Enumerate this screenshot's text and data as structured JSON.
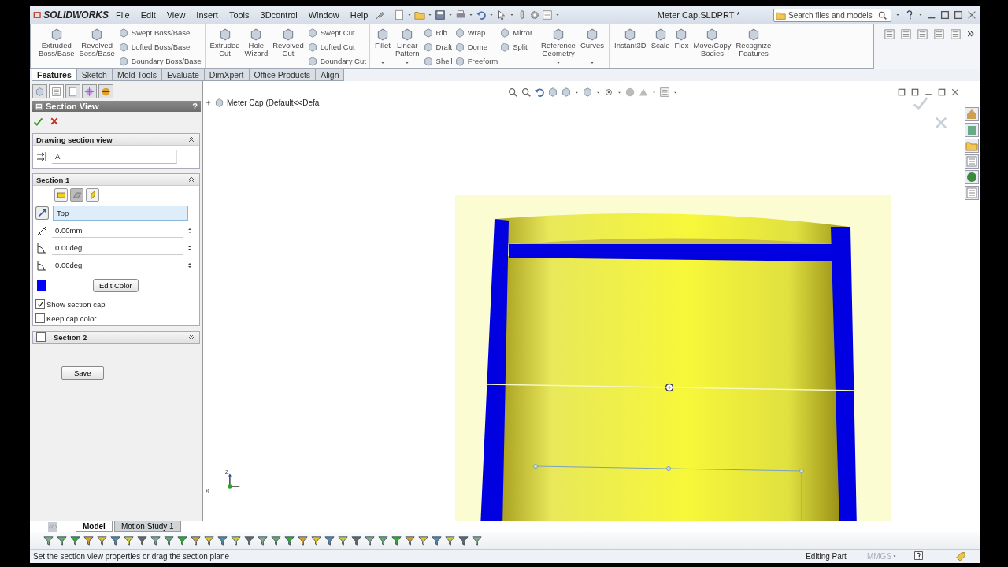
{
  "app": {
    "logo": "SOLIDWORKS",
    "menus": [
      "File",
      "Edit",
      "View",
      "Insert",
      "Tools",
      "3Dcontrol",
      "Window",
      "Help"
    ],
    "title": "Meter Cap.SLDPRT *",
    "search": {
      "placeholder": "Search files and models"
    }
  },
  "ribbon": {
    "groups": [
      [
        {
          "kind": "large",
          "label": "Extruded\nBoss/Base"
        },
        {
          "kind": "large",
          "label": "Revolved\nBoss/Base"
        },
        {
          "kind": "stack",
          "items": [
            "Swept Boss/Base",
            "Lofted Boss/Base",
            "Boundary Boss/Base"
          ]
        }
      ],
      [
        {
          "kind": "large",
          "label": "Extruded\nCut"
        },
        {
          "kind": "large",
          "label": "Hole\nWizard"
        },
        {
          "kind": "large",
          "label": "Revolved\nCut"
        },
        {
          "kind": "stack",
          "items": [
            "Swept Cut",
            "Lofted Cut",
            "Boundary Cut"
          ]
        }
      ],
      [
        {
          "kind": "drop",
          "label": "Fillet"
        },
        {
          "kind": "drop",
          "label": "Linear\nPattern"
        },
        {
          "kind": "stack",
          "items": [
            "Rib",
            "Draft",
            "Shell"
          ]
        },
        {
          "kind": "stack",
          "items": [
            "Wrap",
            "Dome",
            "Freeform"
          ]
        },
        {
          "kind": "stack",
          "items": [
            "Mirror",
            "Split"
          ]
        }
      ],
      [
        {
          "kind": "drop",
          "label": "Reference\nGeometry"
        },
        {
          "kind": "drop",
          "label": "Curves"
        }
      ],
      [
        {
          "kind": "large",
          "label": "Instant3D"
        },
        {
          "kind": "large",
          "label": "Scale"
        },
        {
          "kind": "large",
          "label": "Flex"
        },
        {
          "kind": "large",
          "label": "Move/Copy\nBodies"
        },
        {
          "kind": "large",
          "label": "Recognize\nFeatures"
        }
      ]
    ]
  },
  "tabs": [
    {
      "label": "Features",
      "selected": true
    },
    {
      "label": "Sketch",
      "selected": false
    },
    {
      "label": "Mold Tools",
      "selected": false
    },
    {
      "label": "Evaluate",
      "selected": false
    },
    {
      "label": "DimXpert",
      "selected": false
    },
    {
      "label": "Office Products",
      "selected": false
    },
    {
      "label": "Align",
      "selected": false
    }
  ],
  "panel": {
    "property_tabs": [
      {
        "selected": false
      },
      {
        "selected": true
      },
      {
        "selected": false
      },
      {
        "selected": false
      },
      {
        "selected": false
      }
    ],
    "title": "Section View",
    "help": "?",
    "drawing_section": {
      "title": "Drawing section view",
      "expanded": true,
      "value": "A"
    },
    "section1": {
      "title": "Section 1",
      "expanded": true,
      "planes": [
        {
          "selected": false
        },
        {
          "selected": true
        },
        {
          "selected": false
        }
      ],
      "reference": {
        "value": "Top",
        "active": true
      },
      "values": [
        "0.00mm",
        "0.00deg",
        "0.00deg"
      ],
      "edit_color": "Edit Color",
      "checkboxes": [
        {
          "label": "Show section cap",
          "checked": true
        },
        {
          "label": "Keep cap color",
          "checked": false
        }
      ]
    },
    "section2": {
      "title": "Section 2",
      "checked": false,
      "expanded": false
    },
    "save": "Save"
  },
  "viewport": {
    "tree_label": "Meter Cap  (Default<<Defa",
    "axes": {
      "z": "Z",
      "x": "X"
    }
  },
  "bottom_tabs": [
    {
      "label": "Model",
      "selected": true
    },
    {
      "label": "Motion Study 1",
      "selected": false
    }
  ],
  "status": {
    "message": "Set the section view properties or drag the section plane",
    "mode": "Editing Part",
    "units": "MMGS"
  }
}
